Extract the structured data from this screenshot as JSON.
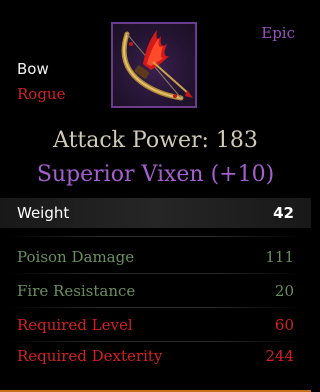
{
  "item": {
    "rarity": "Epic",
    "type": "Bow",
    "class": "Rogue",
    "attack_power": "Attack Power: 183",
    "name": "Superior Vixen (+10)",
    "icon": "bow-icon"
  },
  "weight": {
    "label": "Weight",
    "value": "42"
  },
  "stats": [
    {
      "label": "Poison Damage",
      "value": "111",
      "color": "#6a8f5e"
    },
    {
      "label": "Fire Resistance",
      "value": "20",
      "color": "#6a8f5e"
    },
    {
      "label": "Required Level",
      "value": "60",
      "color": "#d42020"
    },
    {
      "label": "Required Dexterity",
      "value": "244",
      "color": "#d42020"
    }
  ],
  "colors": {
    "epic": "#9b4fbf",
    "requirement": "#d42020",
    "bonus": "#6a8f5e",
    "attack": "#d0cbb6"
  }
}
